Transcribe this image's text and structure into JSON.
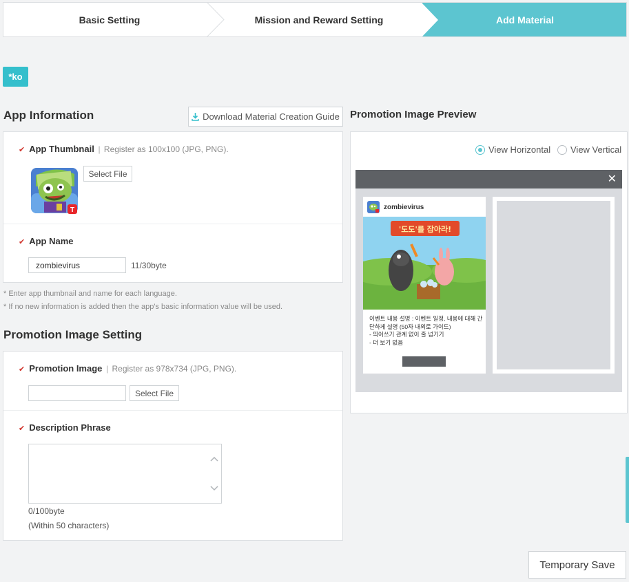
{
  "steps": [
    {
      "label": "Basic Setting"
    },
    {
      "label": "Mission and Reward Setting"
    },
    {
      "label": "Add Material"
    }
  ],
  "language_tag": "*ko",
  "app_info": {
    "title": "App Information",
    "guide_button": "Download Material Creation Guide",
    "thumbnail": {
      "label": "App Thumbnail",
      "hint": "Register as 100x100 (JPG, PNG).",
      "select_button": "Select File"
    },
    "app_name": {
      "label": "App Name",
      "value": "zombievirus",
      "byte_count": "11/30byte"
    },
    "notes": [
      "* Enter app thumbnail and name for each language.",
      "* If no new information is added then the app's basic information value will be used."
    ]
  },
  "promotion": {
    "title": "Promotion Image Setting",
    "image": {
      "label": "Promotion Image",
      "hint": "Register as 978x734 (JPG, PNG).",
      "select_button": "Select File",
      "value": ""
    },
    "description": {
      "label": "Description Phrase",
      "value": "",
      "byte_count": "0/100byte",
      "limit": "(Within 50 characters)"
    }
  },
  "preview": {
    "title": "Promotion Image Preview",
    "view_horizontal": "View Horizontal",
    "view_vertical": "View Vertical",
    "selected_view": "horizontal",
    "app_name": "zombievirus",
    "banner_text": "'도도'를 잡아라!",
    "description": "이벤트 내용 설명 : 이벤트 일정, 내용에 대해 간단하게 설명 (50자 내외로 가이드)\n- 띄어쓰기 관계 없이 줄 넘기기\n- 더 보기 없음"
  },
  "footer": {
    "temporary_save": "Temporary Save"
  },
  "colors": {
    "accent": "#5cc5d0",
    "tag": "#35bfcc",
    "required_mark": "#d0342c"
  }
}
